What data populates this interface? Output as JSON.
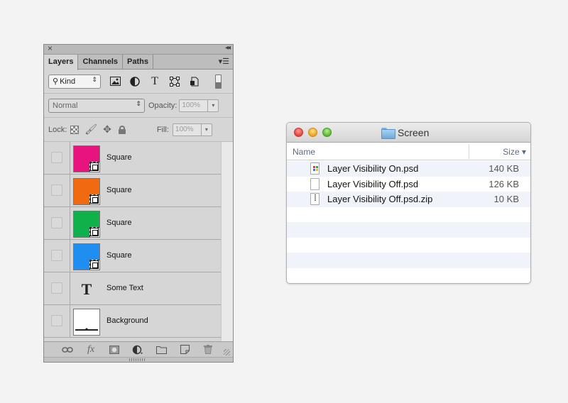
{
  "layers_panel": {
    "tabs": [
      {
        "label": "Layers",
        "active": true
      },
      {
        "label": "Channels",
        "active": false
      },
      {
        "label": "Paths",
        "active": false
      }
    ],
    "filter": {
      "kind_label": "Kind"
    },
    "blend_mode": "Normal",
    "opacity": {
      "label": "Opacity:",
      "value": "100%"
    },
    "lock": {
      "label": "Lock:"
    },
    "fill": {
      "label": "Fill:",
      "value": "100%"
    },
    "layers": [
      {
        "name": "Square",
        "type": "shape",
        "color": "#e8137f"
      },
      {
        "name": "Square",
        "type": "shape",
        "color": "#f26a10"
      },
      {
        "name": "Square",
        "type": "shape",
        "color": "#10b04a"
      },
      {
        "name": "Square",
        "type": "shape",
        "color": "#1e8ff0"
      },
      {
        "name": "Some Text",
        "type": "text",
        "color": "#222222"
      },
      {
        "name": "Background",
        "type": "background",
        "color": "#ffffff"
      }
    ]
  },
  "finder": {
    "title": "Screen",
    "columns": {
      "name": "Name",
      "size": "Size ▾"
    },
    "files": [
      {
        "name": "Layer Visibility On.psd",
        "size": "140 KB",
        "icon": "psd-file-icon"
      },
      {
        "name": "Layer Visibility Off.psd",
        "size": "126 KB",
        "icon": "blank-file-icon"
      },
      {
        "name": "Layer Visibility Off.psd.zip",
        "size": "10 KB",
        "icon": "zip-file-icon"
      }
    ]
  }
}
